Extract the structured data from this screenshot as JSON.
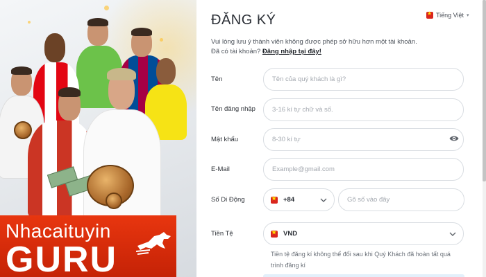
{
  "promo": {
    "brand_top": "Nhacaituyin",
    "brand_bottom": "GURU"
  },
  "form": {
    "title": "ĐĂNG KÝ",
    "title_mark": "'",
    "language": "Tiếng Việt",
    "note": "Vui lòng lưu ý thành viên không được phép sở hữu hơn một tài khoản.",
    "login_prompt": "Đã có tài khoản?",
    "login_link": "Đăng nhập tại đây!",
    "fields": {
      "name": {
        "label": "Tên",
        "placeholder": "Tên của quý khách là gì?"
      },
      "username": {
        "label": "Tên đăng nhập",
        "placeholder": "3-16 kí tự chữ và số."
      },
      "password": {
        "label": "Mật khẩu",
        "placeholder": "8-30 kí tự"
      },
      "email": {
        "label": "E-Mail",
        "placeholder": "Example@gmail.com"
      },
      "phone": {
        "label": "Số Di Động",
        "country_code": "+84",
        "placeholder": "Gõ số vào đây"
      },
      "currency": {
        "label": "Tiền Tệ",
        "value": "VND",
        "note": "Tiền tệ đăng kí không thể đổi sau khi Quý Khách đã hoàn tất quá trình đăng kí"
      }
    }
  },
  "icons": {
    "flag": "vietnam-flag-icon",
    "eye": "eye-icon",
    "chevron": "chevron-down-icon"
  },
  "colors": {
    "brand_red": "#d9300c",
    "flag_red": "#da251d",
    "flag_star": "#ffde00",
    "border": "#d9dde2"
  }
}
